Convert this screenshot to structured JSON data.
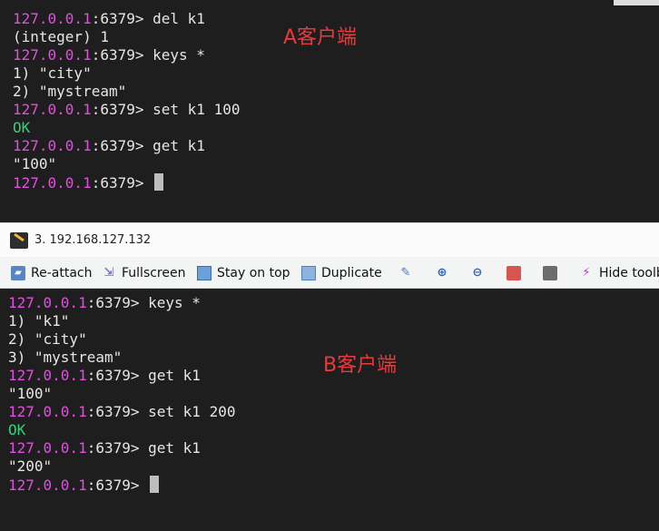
{
  "terminal_a": {
    "lines": [
      {
        "host": "127.0.0.1",
        "port": ":6379> ",
        "cmd": "del k1"
      },
      {
        "out": "(integer) 1"
      },
      {
        "host": "127.0.0.1",
        "port": ":6379> ",
        "cmd": "keys *"
      },
      {
        "out": "1) \"city\""
      },
      {
        "out": "2) \"mystream\""
      },
      {
        "host": "127.0.0.1",
        "port": ":6379> ",
        "cmd": "set k1 100"
      },
      {
        "ok": "OK"
      },
      {
        "host": "127.0.0.1",
        "port": ":6379> ",
        "cmd": "get k1"
      },
      {
        "out": "\"100\""
      },
      {
        "host": "127.0.0.1",
        "port": ":6379> ",
        "cmd": ""
      }
    ],
    "annotation": "A客户端"
  },
  "window_b": {
    "title": "3. 192.168.127.132",
    "toolbar": {
      "reattach": "Re-attach",
      "fullscreen": "Fullscreen",
      "stay_on_top": "Stay on top",
      "duplicate": "Duplicate",
      "hide_toolbar": "Hide toolba"
    }
  },
  "terminal_b": {
    "lines": [
      {
        "host": "127.0.0.1",
        "port": ":6379> ",
        "cmd": "keys *"
      },
      {
        "out": "1) \"k1\""
      },
      {
        "out": "2) \"city\""
      },
      {
        "out": "3) \"mystream\""
      },
      {
        "host": "127.0.0.1",
        "port": ":6379> ",
        "cmd": "get k1"
      },
      {
        "out": "\"100\""
      },
      {
        "host": "127.0.0.1",
        "port": ":6379> ",
        "cmd": "set k1 200"
      },
      {
        "ok": "OK"
      },
      {
        "host": "127.0.0.1",
        "port": ":6379> ",
        "cmd": "get k1"
      },
      {
        "out": "\"200\""
      },
      {
        "host": "127.0.0.1",
        "port": ":6379> ",
        "cmd": ""
      }
    ],
    "annotation": "B客户端"
  },
  "colors": {
    "prompt_host": "#e24fe0",
    "ok": "#33d17a",
    "annotation": "#e8393b",
    "terminal_bg": "#1e1e1e"
  },
  "icons": {
    "reattach": "reattach-icon",
    "fullscreen": "fullscreen-icon",
    "stay_on_top": "stay-on-top-icon",
    "duplicate": "duplicate-icon",
    "edit": "edit-icon",
    "zoom_in": "zoom-in-icon",
    "zoom_out": "zoom-out-icon",
    "save": "save-icon",
    "print": "print-icon",
    "hide_toolbar": "hide-toolbar-icon"
  }
}
